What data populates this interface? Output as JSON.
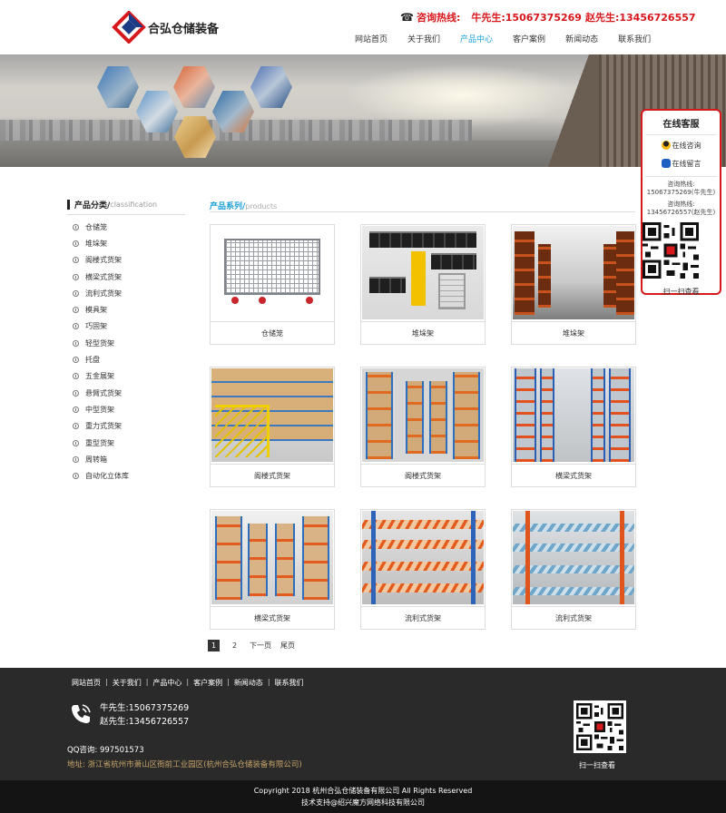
{
  "header": {
    "logo_text": "合弘仓储装备",
    "hotline_label": "咨询热线:",
    "hotline_1": "牛先生:15067375269",
    "hotline_2": "赵先生:13456726557"
  },
  "nav": {
    "items": [
      {
        "label": "网站首页",
        "active": false
      },
      {
        "label": "关于我们",
        "active": false
      },
      {
        "label": "产品中心",
        "active": true
      },
      {
        "label": "客户案例",
        "active": false
      },
      {
        "label": "新闻动态",
        "active": false
      },
      {
        "label": "联系我们",
        "active": false
      }
    ]
  },
  "kefu": {
    "title": "在线客服",
    "online_consult": "在线咨询",
    "online_message": "在线留言",
    "tel1_label": "咨询热线:",
    "tel1_value": "15067375269(牛先生)",
    "tel2_label": "咨询热线:",
    "tel2_value": "13456726557(赵先生)",
    "scan": "扫一扫查看"
  },
  "sidebar": {
    "title": "产品分类/",
    "subtitle": "classification",
    "items": [
      "仓储笼",
      "堆垛架",
      "阁楼式货架",
      "横梁式货架",
      "流利式货架",
      "模具架",
      "巧固架",
      "轻型货架",
      "托盘",
      "五金展架",
      "悬臂式货架",
      "中型货架",
      "重力式货架",
      "重型货架",
      "周转箱",
      "自动化立体库"
    ]
  },
  "main": {
    "title": "产品系列/",
    "subtitle": "products",
    "products": [
      {
        "caption": "仓储笼"
      },
      {
        "caption": "堆垛架"
      },
      {
        "caption": "堆垛架"
      },
      {
        "caption": "阁楼式货架"
      },
      {
        "caption": "阁楼式货架"
      },
      {
        "caption": "横梁式货架"
      },
      {
        "caption": "横梁式货架"
      },
      {
        "caption": "流利式货架"
      },
      {
        "caption": "流利式货架"
      }
    ]
  },
  "pager": {
    "p1": "1",
    "p2": "2",
    "next": "下一页",
    "last": "尾页"
  },
  "footer": {
    "nav": [
      "网站首页",
      "关于我们",
      "产品中心",
      "客户案例",
      "新闻动态",
      "联系我们"
    ],
    "tel1": "牛先生:15067375269",
    "tel2": "赵先生:13456726557",
    "qq": "QQ咨询: 997501573",
    "address": "地址: 浙江省杭州市萧山区衙前工业园区(杭州合弘仓储装备有限公司)",
    "scan": "扫一扫查看",
    "copyright": "Copyright 2018 杭州合弘仓储装备有限公司 All Rights Reserved",
    "support": "技术支持@绍兴魔方网络科技有限公司"
  },
  "colors": {
    "accent_blue": "#1a9fd6",
    "hotline_red": "#d8161b",
    "footer_bg": "#2a2a2a",
    "address_gold": "#c8a46a"
  }
}
